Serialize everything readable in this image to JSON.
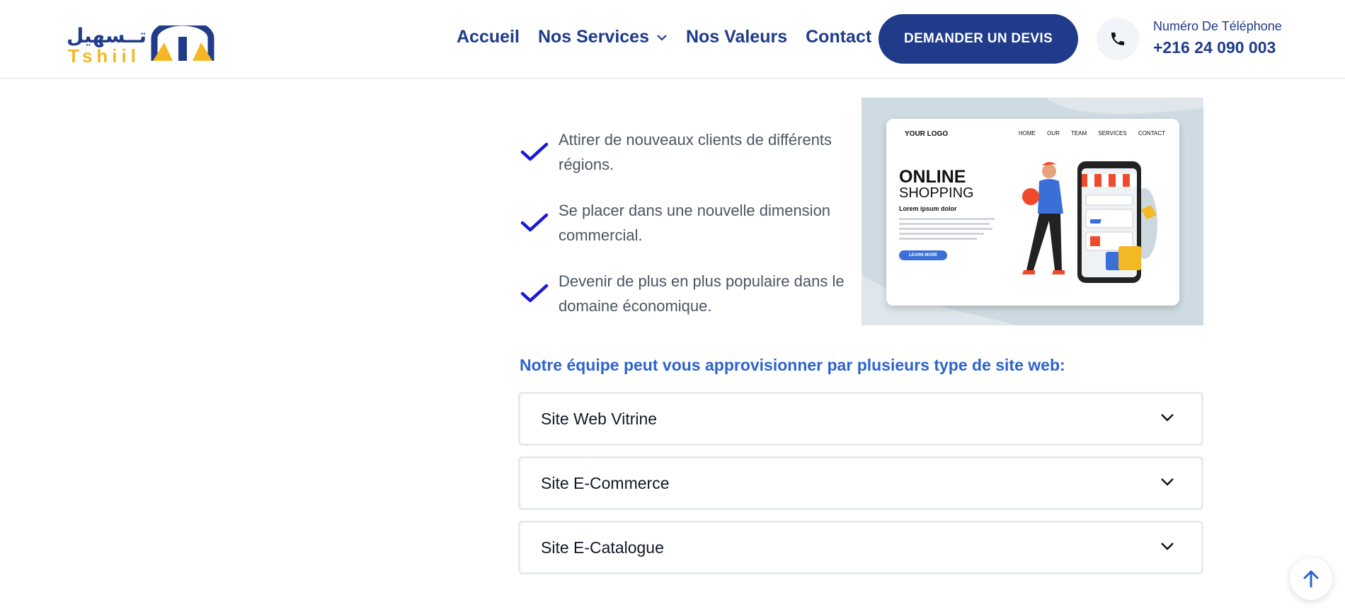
{
  "header": {
    "logo": {
      "arabic": "تــسهيل",
      "latin": "Tshiil"
    },
    "nav": [
      {
        "label": "Accueil"
      },
      {
        "label": "Nos Services"
      },
      {
        "label": "Nos Valeurs"
      },
      {
        "label": "Contact"
      }
    ],
    "cta_label": "DEMANDER UN DEVIS",
    "phone": {
      "label": "Numéro De Téléphone",
      "number": "+216 24 090 003"
    }
  },
  "features": [
    {
      "text": "Attirer de nouveaux clients de différents régions."
    },
    {
      "text": "Se placer dans une nouvelle dimension commercial."
    },
    {
      "text": "Devenir de plus en plus populaire dans le domaine économique."
    }
  ],
  "illustration": {
    "logo": "YOUR LOGO",
    "nav": "HOME OUR TEAM SERVICES CONTACT",
    "headline_1": "ONLINE",
    "headline_2": "SHOPPING",
    "lorem": "Lorem ipsum dolor",
    "button": "LEARN MORE"
  },
  "section_title": "Notre équipe peut vous approvisionner par plusieurs type de site web:",
  "accordion": [
    {
      "label": "Site Web Vitrine"
    },
    {
      "label": "Site E-Commerce"
    },
    {
      "label": "Site E-Catalogue"
    }
  ],
  "colors": {
    "primary": "#1f3b8a",
    "accent": "#f4b825",
    "link_blue": "#2d63cf",
    "check": "#1a1ad6"
  }
}
